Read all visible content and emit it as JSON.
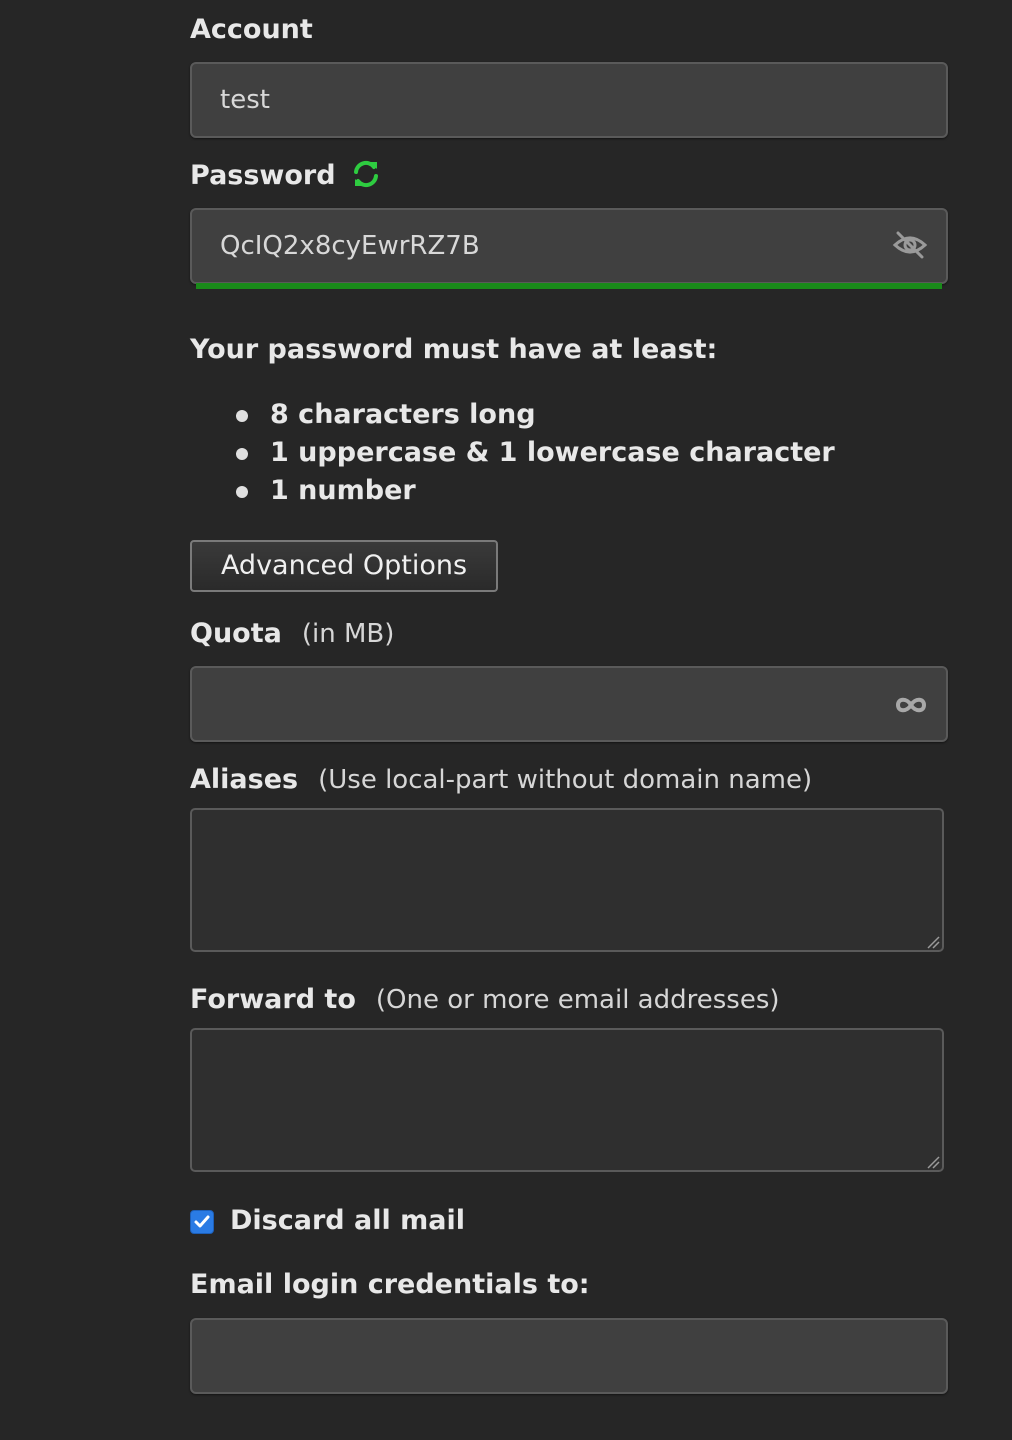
{
  "account": {
    "label": "Account",
    "value": "test"
  },
  "password": {
    "label": "Password",
    "value": "QcIQ2x8cyEwrRZ7B",
    "regenerate_icon": "refresh-icon",
    "visibility_icon": "eye-slash-icon",
    "strength_color": "#1a8a1a",
    "strength": 1.0
  },
  "requirements": {
    "title": "Your password must have at least:",
    "items": [
      "8 characters long",
      "1 uppercase & 1 lowercase character",
      "1 number"
    ]
  },
  "advanced_options": {
    "label": "Advanced Options"
  },
  "quota": {
    "label": "Quota",
    "hint": "(in MB)",
    "value": "",
    "icon": "infinity-icon"
  },
  "aliases": {
    "label": "Aliases",
    "hint": "(Use local-part without domain name)",
    "value": ""
  },
  "forward": {
    "label": "Forward to",
    "hint": "(One or more email addresses)",
    "value": ""
  },
  "discard": {
    "label": "Discard all mail",
    "checked": true,
    "accent": "#2a7be4"
  },
  "email_credentials": {
    "label": "Email login credentials to:",
    "value": ""
  }
}
